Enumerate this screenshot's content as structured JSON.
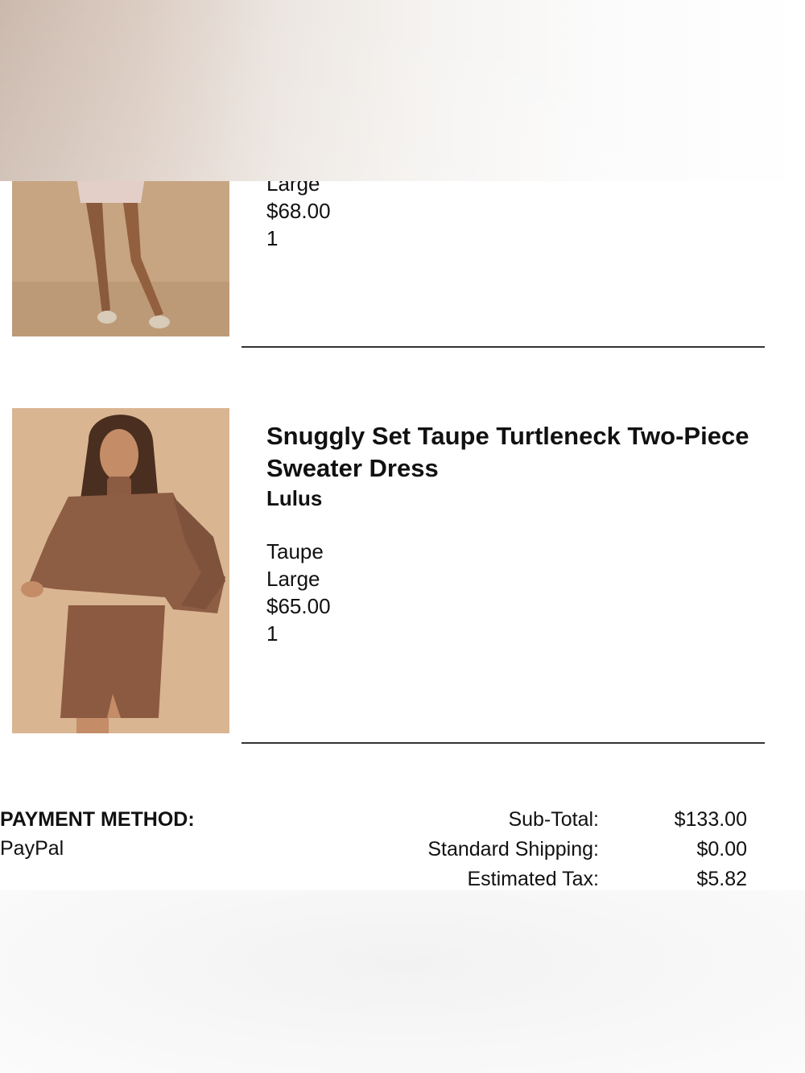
{
  "items": [
    {
      "title": "",
      "brand": "",
      "size": "Large",
      "price": "$68.00",
      "quantity": "1"
    },
    {
      "title": "Snuggly Set Taupe Turtleneck Two-Piece Sweater Dress",
      "brand": "Lulus",
      "color": "Taupe",
      "size": "Large",
      "price": "$65.00",
      "quantity": "1"
    }
  ],
  "payment": {
    "label": "PAYMENT METHOD:",
    "value": "PayPal"
  },
  "totals": [
    {
      "label": "Sub-Total:",
      "value": "$133.00"
    },
    {
      "label": "Standard Shipping:",
      "value": "$0.00"
    },
    {
      "label": "Estimated Tax:",
      "value": "$5.82"
    }
  ]
}
